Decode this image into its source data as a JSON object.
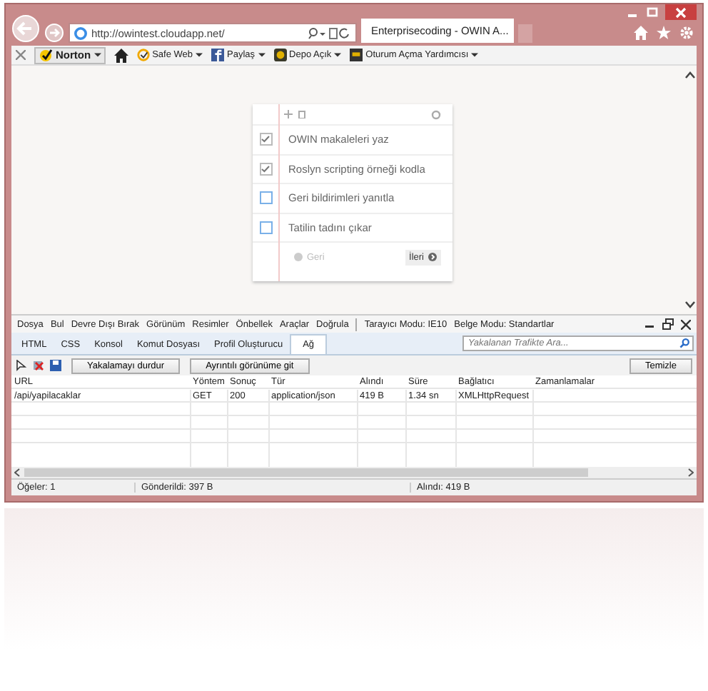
{
  "browser": {
    "address": "http://owintest.cloudapp.net/",
    "tab_title": "Enterprisecoding - OWIN A...",
    "favorites": [
      {
        "label": "Norton",
        "kind": "norton",
        "dropdown": true
      },
      {
        "label": "Safe Web",
        "kind": "safeweb",
        "dropdown": true
      },
      {
        "label": "Paylaş",
        "kind": "facebook",
        "dropdown": true
      },
      {
        "label": "Depo Açık",
        "kind": "vault",
        "dropdown": true
      },
      {
        "label": "Oturum Açma Yardımcısı",
        "kind": "login",
        "dropdown": true
      }
    ]
  },
  "todo": {
    "items": [
      {
        "text": "OWIN makaleleri yaz",
        "checked": true
      },
      {
        "text": "Roslyn scripting örneği kodla",
        "checked": true
      },
      {
        "text": "Geri bildirimleri yanıtla",
        "checked": false
      },
      {
        "text": "Tatilin tadını çıkar",
        "checked": false
      }
    ],
    "buttons": [
      {
        "label": "Geri",
        "disabled": true
      },
      {
        "label": "İleri",
        "disabled": false
      }
    ]
  },
  "devtools": {
    "menu": [
      "Dosya",
      "Bul",
      "Devre Dışı Bırak",
      "Görünüm",
      "Resimler",
      "Önbellek",
      "Araçlar",
      "Doğrula"
    ],
    "modes": [
      "Tarayıcı Modu: IE10",
      "Belge Modu: Standartlar"
    ],
    "tabs": [
      {
        "label": "HTML",
        "selected": false
      },
      {
        "label": "CSS",
        "selected": false
      },
      {
        "label": "Konsol",
        "selected": false
      },
      {
        "label": "Komut Dosyası",
        "selected": false
      },
      {
        "label": "Profil Oluşturucu",
        "selected": false
      },
      {
        "label": "Ağ",
        "selected": true
      }
    ],
    "search": {
      "placeholder": "Yakalanan Trafikte Ara..."
    },
    "buttons": [
      "Yakalamayı durdur",
      "Ayrıntılı görünüme git"
    ],
    "clear_button": "Temizle",
    "table": {
      "columns": [
        "URL",
        "Yöntem",
        "Sonuç",
        "Tür",
        "Alındı",
        "Süre",
        "Bağlatıcı",
        "Zamanlamalar"
      ],
      "rows": [
        [
          "/api/yapilacaklar",
          "GET",
          "200",
          "application/json",
          "419 B",
          "1.34 sn",
          "XMLHttpRequest",
          ""
        ]
      ]
    },
    "status_bar": [
      "Öğeler: 1",
      "Gönderildi: 397 B",
      "Alındı: 419 B"
    ]
  }
}
